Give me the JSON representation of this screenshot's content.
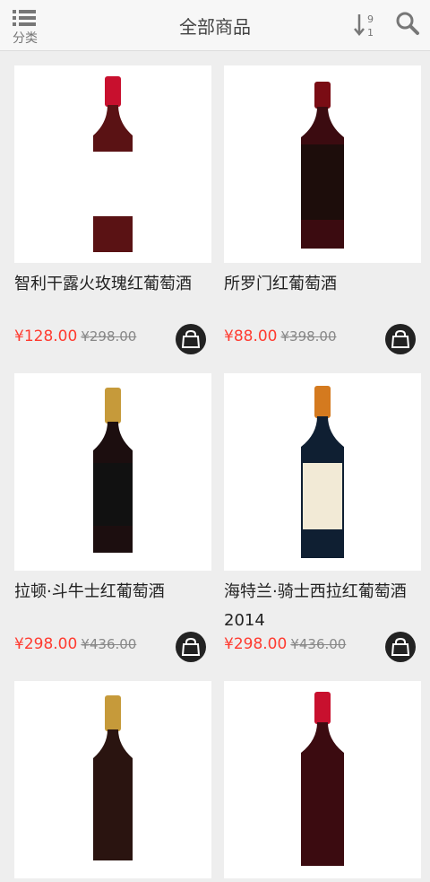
{
  "header": {
    "category_label": "分类",
    "title": "全部商品"
  },
  "products": [
    {
      "name": "智利干露火玫瑰红葡萄酒",
      "price": "¥128.00",
      "old_price": "¥298.00",
      "bottle": {
        "cap": "#c8102e",
        "body": "#5a1214",
        "label": "#ffffff"
      }
    },
    {
      "name": "所罗门红葡萄酒",
      "price": "¥88.00",
      "old_price": "¥398.00",
      "bottle": {
        "cap": "#7a0c14",
        "body": "#3b0b10",
        "label": "#1d0d0b"
      }
    },
    {
      "name": "拉顿·斗牛士红葡萄酒",
      "price": "¥298.00",
      "old_price": "¥436.00",
      "bottle": {
        "cap": "#c69a3a",
        "body": "#1c0e0f",
        "label": "#111111"
      }
    },
    {
      "name": "海特兰·骑士西拉红葡萄酒 2014",
      "price": "¥298.00",
      "old_price": "¥436.00",
      "bottle": {
        "cap": "#d47a1f",
        "body": "#0f1f32",
        "label": "#f2ead6"
      }
    },
    {
      "name": "",
      "price": "",
      "old_price": "",
      "bottle": {
        "cap": "#c69a3a",
        "body": "#2a1410",
        "label": "#222222"
      }
    },
    {
      "name": "",
      "price": "",
      "old_price": "",
      "bottle": {
        "cap": "#c8102e",
        "body": "#3b0b10",
        "label": "#ffffff"
      }
    }
  ]
}
